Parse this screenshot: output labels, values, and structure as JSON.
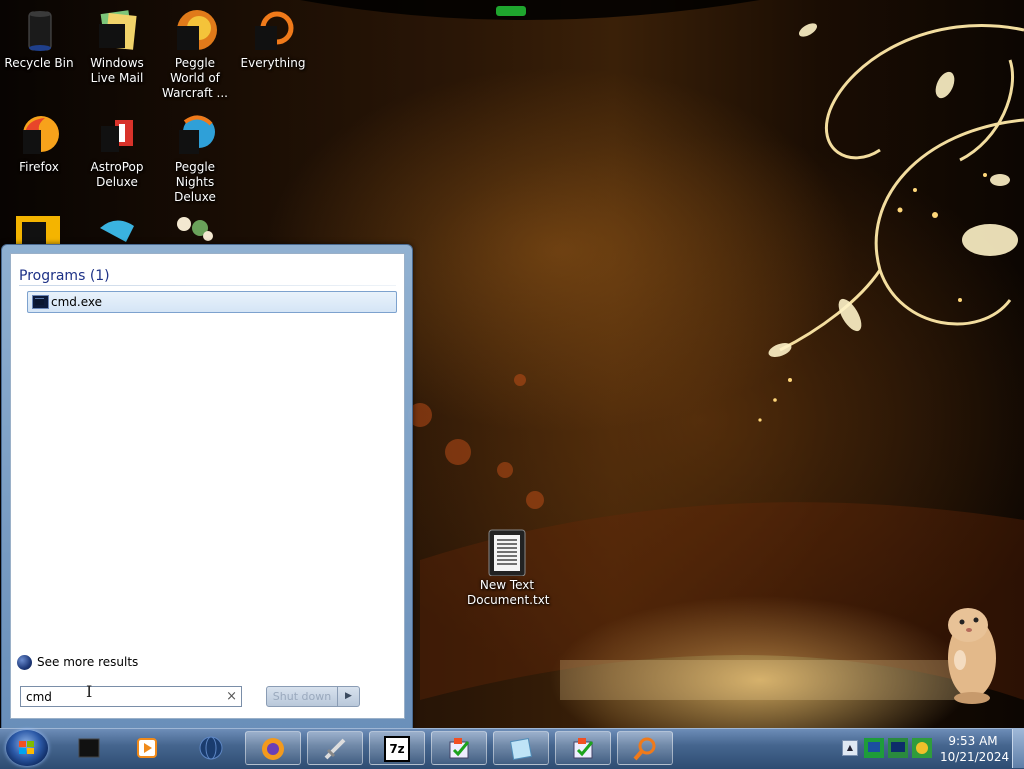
{
  "desktop": {
    "icons": [
      {
        "label": "Recycle Bin",
        "icon": "recycle-bin-icon"
      },
      {
        "label": "Windows Live Mail",
        "icon": "mail-icon"
      },
      {
        "label": "Peggle World of Warcraft ...",
        "icon": "peggle-icon"
      },
      {
        "label": "Everything",
        "icon": "search-app-icon"
      },
      {
        "label": "Firefox",
        "icon": "firefox-icon"
      },
      {
        "label": "AstroPop Deluxe",
        "icon": "astropop-icon"
      },
      {
        "label": "Peggle Nights Deluxe",
        "icon": "peggle-nights-icon"
      },
      {
        "label": "New Text Document.txt",
        "icon": "text-document-icon"
      }
    ]
  },
  "start_menu": {
    "results_header": "Programs (1)",
    "results": [
      {
        "label": "cmd.exe",
        "icon": "console-icon"
      }
    ],
    "see_more_label": "See more results",
    "search": {
      "value": "cmd",
      "clear_glyph": "×"
    },
    "shutdown_label": "Shut down",
    "shutdown_arrow": "▶"
  },
  "taskbar": {
    "tray_arrow": "▲",
    "clock": {
      "time": "9:53 AM",
      "date": "10/21/2024"
    },
    "items": [
      {
        "name": "file-manager",
        "state": "pinned"
      },
      {
        "name": "media-player",
        "state": "pinned"
      },
      {
        "name": "browser-globe",
        "state": "pinned"
      },
      {
        "name": "firefox",
        "state": "open"
      },
      {
        "name": "sword-app",
        "state": "open"
      },
      {
        "name": "7zip",
        "state": "open",
        "label": "7z"
      },
      {
        "name": "flag-checklist",
        "state": "open"
      },
      {
        "name": "notepad",
        "state": "open"
      },
      {
        "name": "flag-checklist-2",
        "state": "open"
      },
      {
        "name": "everything-search",
        "state": "open"
      }
    ]
  },
  "colors": {
    "accent": "#1e3287",
    "taskbar": "#46668f",
    "selection": "#d5e5f6"
  }
}
